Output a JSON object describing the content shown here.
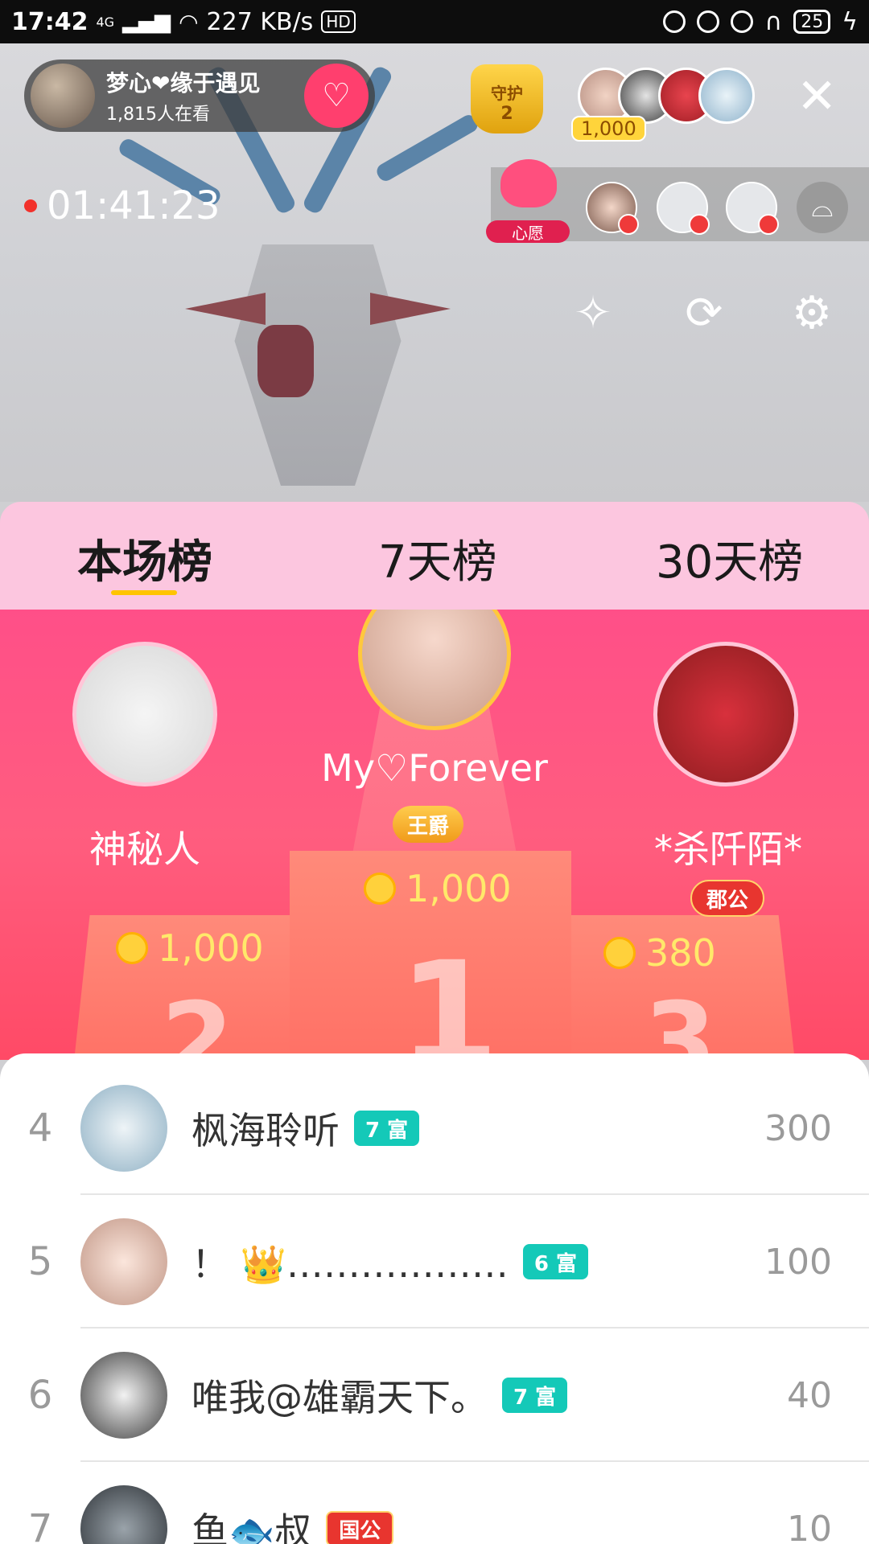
{
  "status": {
    "time": "17:42",
    "speed": "227 KB/s",
    "net": "4G",
    "hd": "HD",
    "battery": "25"
  },
  "host": {
    "name": "梦心❤缘于遇见",
    "viewers": "1,815人在看",
    "follow_icon": "heart-plus-icon"
  },
  "guard": {
    "label": "守护",
    "count": "2"
  },
  "top_viewers": {
    "coin_total": "1,000"
  },
  "live": {
    "timer": "01:41:23"
  },
  "wish": {
    "label": "心愿"
  },
  "tabs": [
    {
      "label": "本场榜"
    },
    {
      "label": "7天榜"
    },
    {
      "label": "30天榜"
    }
  ],
  "podium": {
    "first": {
      "name": "My♡Forever",
      "title": "王爵",
      "score": "1,000"
    },
    "second": {
      "name": "神秘人",
      "score": "1,000"
    },
    "third": {
      "name": "*杀阡陌*",
      "title": "郡公",
      "score": "380"
    }
  },
  "list": [
    {
      "rank": "4",
      "name": "枫海聆听",
      "badge": "7 富",
      "score": "300"
    },
    {
      "rank": "5",
      "name": "！ 👑………………",
      "badge": "6 富",
      "score": "100"
    },
    {
      "rank": "6",
      "name": "唯我@雄霸天下。",
      "badge": "7 富",
      "score": "40"
    },
    {
      "rank": "7",
      "name": "鱼🐟叔",
      "badge": "国公",
      "score": "10"
    }
  ],
  "colors": {
    "accent": "#ff4f88",
    "rich_badge": "#14c9b8",
    "title_badge": "#e8352f",
    "gold": "#ffd13b"
  }
}
